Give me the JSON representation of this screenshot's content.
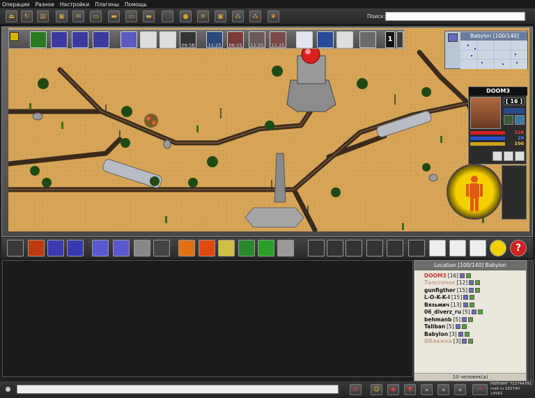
{
  "menu": {
    "items": [
      "Операции",
      "Разное",
      "Настройки",
      "Плагины",
      "Помощь"
    ]
  },
  "toolbar": {
    "search_label": "Поиск:",
    "search_value": ""
  },
  "skills": {
    "timers": [
      "09:58",
      "11:25",
      "06:25",
      "11:25",
      "11:25"
    ]
  },
  "minimap": {
    "title": "Babylon [100/140]"
  },
  "player": {
    "name": "DOOM3",
    "level": "[ 16 ]",
    "hp": "328",
    "mp": "29",
    "energy": "100"
  },
  "location": {
    "title": "Location [100/140] Babylon",
    "players": [
      {
        "name": "DOOM3",
        "level": "[16]",
        "color": "#c0392b"
      },
      {
        "name": "Толстячок",
        "level": "[12]",
        "color": "#c9a090"
      },
      {
        "name": "gunfigther",
        "level": "[15]",
        "color": "#111111"
      },
      {
        "name": "L-O-K-K-I",
        "level": "[15]",
        "color": "#111111"
      },
      {
        "name": "Вязьмич",
        "level": "[13]",
        "color": "#111111"
      },
      {
        "name": "06_diverz_ru",
        "level": "[5]",
        "color": "#111111"
      },
      {
        "name": "behmanb",
        "level": "[5]",
        "color": "#111111"
      },
      {
        "name": "Taliban",
        "level": "[5]",
        "color": "#111111"
      },
      {
        "name": "Babylon",
        "level": "[3]",
        "color": "#111111"
      },
      {
        "name": "Облажка",
        "level": "[3]",
        "color": "#c9a090"
      }
    ],
    "count": "10 человек(а)"
  },
  "footer": {
    "rating_label": "РЕЙТИНГ 722744791",
    "rating_values": "mail.ru 162740  14562"
  },
  "colors": {
    "sand": "#d6a456",
    "road": "#3a2a1c",
    "frame": "#555555",
    "accent_yellow": "#f4d000"
  }
}
